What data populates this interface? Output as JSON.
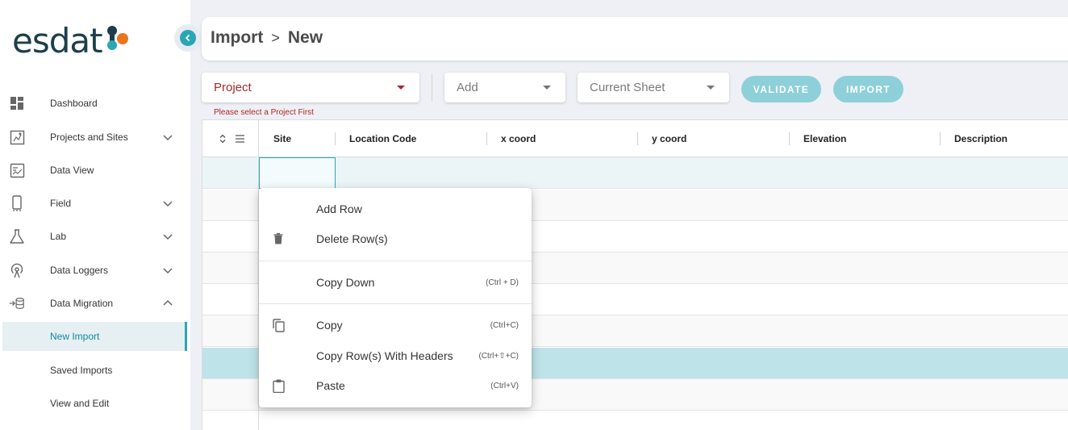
{
  "app": {
    "logo_text": "esdat"
  },
  "sidebar": {
    "items": [
      {
        "label": "Dashboard",
        "icon": "dashboard-icon",
        "expandable": false
      },
      {
        "label": "Projects and Sites",
        "icon": "map-icon",
        "expandable": true,
        "expanded": false
      },
      {
        "label": "Data View",
        "icon": "data-view-icon",
        "expandable": false
      },
      {
        "label": "Field",
        "icon": "phone-icon",
        "expandable": true,
        "expanded": false
      },
      {
        "label": "Lab",
        "icon": "flask-icon",
        "expandable": true,
        "expanded": false
      },
      {
        "label": "Data Loggers",
        "icon": "antenna-icon",
        "expandable": true,
        "expanded": false
      },
      {
        "label": "Data Migration",
        "icon": "database-import-icon",
        "expandable": true,
        "expanded": true
      }
    ],
    "sub_items": [
      {
        "label": "New Import",
        "active": true
      },
      {
        "label": "Saved Imports",
        "active": false
      },
      {
        "label": "View and Edit",
        "active": false
      }
    ]
  },
  "header": {
    "crumb_root": "Import",
    "crumb_sep": ">",
    "crumb_current": "New"
  },
  "toolbar": {
    "project_value": "Project",
    "project_error": "Please select a Project First",
    "add_value": "Add",
    "sheet_value": "Current Sheet",
    "validate_label": "VALIDATE",
    "import_label": "IMPORT"
  },
  "grid": {
    "columns": [
      "Site",
      "Location Code",
      "x coord",
      "y coord",
      "Elevation",
      "Description"
    ]
  },
  "context_menu": {
    "items": [
      {
        "label": "Add Row",
        "shortcut": "",
        "icon": ""
      },
      {
        "label": "Delete Row(s)",
        "shortcut": "",
        "icon": "trash-icon"
      },
      {
        "label": "Copy Down",
        "shortcut": "(Ctrl + D)",
        "icon": ""
      },
      {
        "label": "Copy",
        "shortcut": "(Ctrl+C)",
        "icon": "copy-icon"
      },
      {
        "label": "Copy Row(s) With Headers",
        "shortcut": "(Ctrl+⇧+C)",
        "icon": ""
      },
      {
        "label": "Paste",
        "shortcut": "(Ctrl+V)",
        "icon": "clipboard-icon"
      }
    ]
  },
  "colors": {
    "accent": "#2aa6b5",
    "error": "#b02525",
    "button_disabled": "#8dd0d9",
    "logo_dark": "#1d3e4a",
    "logo_orange": "#e8761c"
  }
}
